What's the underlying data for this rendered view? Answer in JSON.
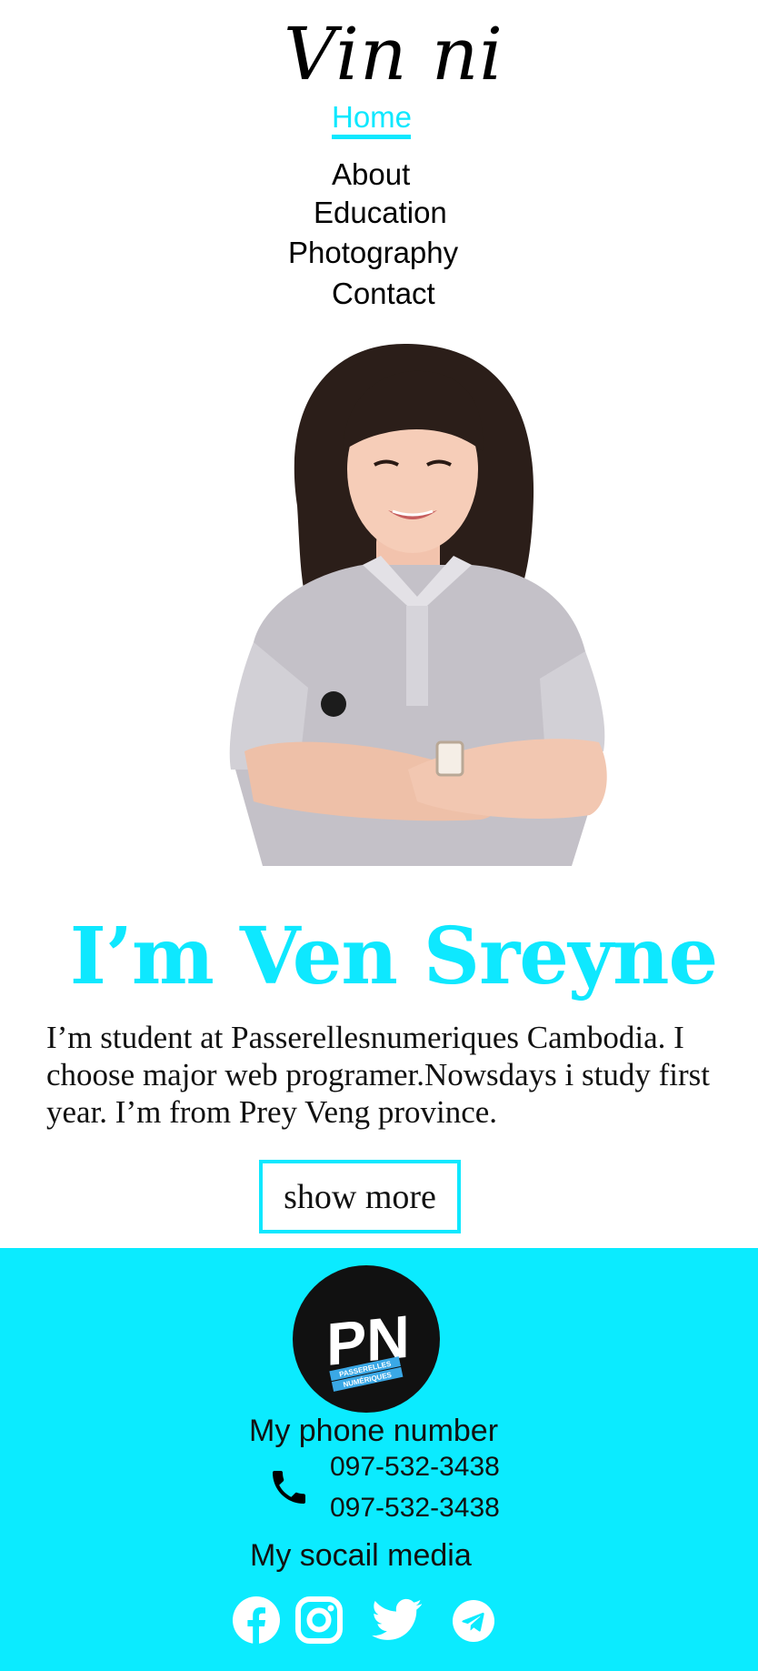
{
  "brand": {
    "logo_text": "Vin ni"
  },
  "nav": {
    "items": [
      {
        "label": "Home",
        "active": true
      },
      {
        "label": "About",
        "active": false
      },
      {
        "label": "Education",
        "active": false
      },
      {
        "label": "Photography",
        "active": false
      },
      {
        "label": "Contact",
        "active": false
      }
    ]
  },
  "hero": {
    "name": "I’m Ven Sreyne",
    "bio": "I’m student at Passerellesnumeriques Cambodia. I choose major web programer.Nowsdays i study first year. I’m from Prey Veng province.",
    "button_label": "show more"
  },
  "footer": {
    "logo_letters": "PN",
    "logo_line1": "PASSERELLES",
    "logo_line2": "NUMÉRIQUES",
    "phone_title": "My phone number",
    "phones": [
      "097-532-3438",
      "097-532-3438"
    ],
    "social_title": "My socail media",
    "social_icons": [
      "facebook-icon",
      "instagram-icon",
      "twitter-icon",
      "telegram-icon"
    ]
  },
  "colors": {
    "accent": "#0ee8ff",
    "footer_bg": "#0bebff",
    "text": "#111111"
  }
}
